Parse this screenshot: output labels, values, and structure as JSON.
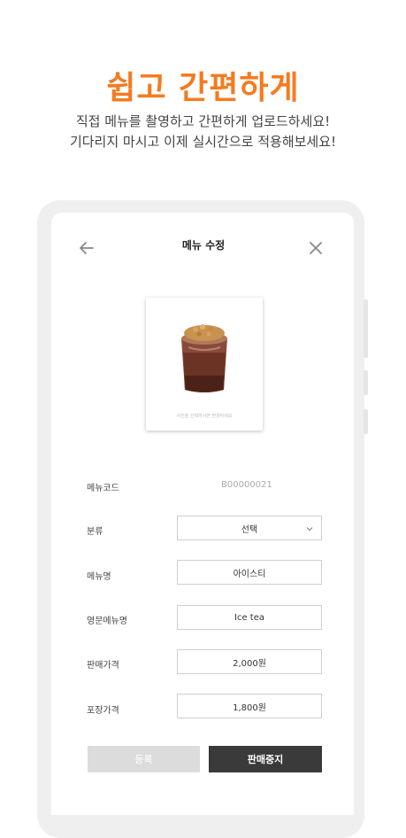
{
  "promo": {
    "headline": "쉽고 간편하게",
    "line1": "직접 메뉴를 촬영하고 간편하게 업로드하세요!",
    "line2": "기다리지 마시고 이제 실시간으로 적용해보세요!"
  },
  "colors": {
    "accent": "#f47b20",
    "dark_button": "#3a3a3a",
    "disabled_button": "#dcdcdc"
  },
  "screen": {
    "title": "메뉴 수정",
    "photo_caption": "사진을 선택하시면 변경하세요"
  },
  "form": {
    "code": {
      "label": "메뉴코드",
      "value": "B00000021"
    },
    "category": {
      "label": "분류",
      "value": "선택"
    },
    "name": {
      "label": "메뉴명",
      "value": "아이스티"
    },
    "english_name": {
      "label": "영문메뉴명",
      "value": "Ice tea"
    },
    "price": {
      "label": "판매가격",
      "value": "2,000원"
    },
    "takeout_price": {
      "label": "포장가격",
      "value": "1,800원"
    }
  },
  "buttons": {
    "confirm": "등록",
    "stop_sale": "판매중지"
  },
  "icons": [
    "back-arrow-icon",
    "close-icon",
    "chevron-down-icon"
  ]
}
